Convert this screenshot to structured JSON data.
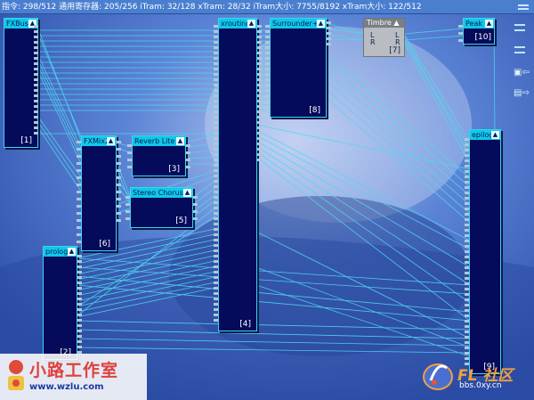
{
  "status": {
    "text": "指令: 298/512 通用寄存器: 205/256 iTram: 32/128 xTram: 28/32 iTram大小: 7755/8192 xTram大小: 122/512"
  },
  "blocks": {
    "fxbus": {
      "title": "FXBus",
      "num": "[1]"
    },
    "xrouting": {
      "title": "xrouting",
      "num": "[4]"
    },
    "surrounder": {
      "title": "Surrounder+",
      "num": "[8]"
    },
    "peak": {
      "title": "Peak",
      "num": "[10]"
    },
    "fxmix2": {
      "title": "FXMix2",
      "num": "[6]"
    },
    "reverb": {
      "title": "Reverb Lite",
      "num": "[3]"
    },
    "chorus": {
      "title": "Stereo Chorus",
      "num": "[5]"
    },
    "prolog": {
      "title": "prolog",
      "num": "[2]"
    },
    "epilog": {
      "title": "epilog",
      "num": "[9]"
    }
  },
  "timbre": {
    "title": "Timbre",
    "in_l": "L",
    "in_r": "R",
    "out_l": "L",
    "out_r": "R",
    "num": "[7]"
  },
  "logos": {
    "left_title": "小路工作室",
    "left_url": "www.wzlu.com",
    "right_title": "FL 社区",
    "right_url": "bbs.0xy.cn"
  },
  "icons": {
    "close": "close-icon",
    "menu1": "menu-icon",
    "menu2": "menu-icon",
    "export": "export-icon",
    "import": "import-icon"
  }
}
